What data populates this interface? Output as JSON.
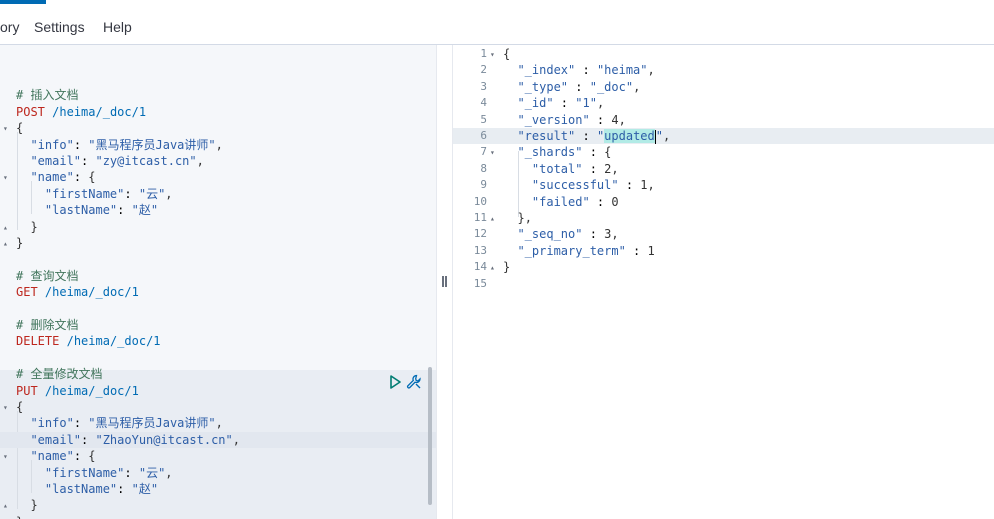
{
  "menu": {
    "history": "ory",
    "settings": "Settings",
    "help": "Help"
  },
  "left": {
    "lines": [
      "",
      "# 插入文档",
      "POST /heima/_doc/1",
      "{",
      "  \"info\": \"黑马程序员Java讲师\",",
      "  \"email\": \"zy@itcast.cn\",",
      "  \"name\": {",
      "    \"firstName\": \"云\",",
      "    \"lastName\": \"赵\"",
      "  }",
      "}",
      "",
      "# 查询文档",
      "GET /heima/_doc/1",
      "",
      "# 删除文档",
      "DELETE /heima/_doc/1",
      "",
      "# 全量修改文档",
      "PUT /heima/_doc/1",
      "{",
      "  \"info\": \"黑马程序员Java讲师\",",
      "  \"email\": \"ZhaoYun@itcast.cn\",",
      "  \"name\": {",
      "    \"firstName\": \"云\",",
      "    \"lastName\": \"赵\"",
      "  }",
      "}"
    ]
  },
  "right": {
    "line_numbers": [
      "1",
      "2",
      "3",
      "4",
      "5",
      "6",
      "7",
      "8",
      "9",
      "10",
      "11",
      "12",
      "13",
      "14",
      "15"
    ],
    "lines": [
      "{",
      "  \"_index\" : \"heima\",",
      "  \"_type\" : \"_doc\",",
      "  \"_id\" : \"1\",",
      "  \"_version\" : 4,",
      "  \"result\" : \"updated\",",
      "  \"_shards\" : {",
      "    \"total\" : 2,",
      "    \"successful\" : 1,",
      "    \"failed\" : 0",
      "  },",
      "  \"_seq_no\" : 3,",
      "  \"_primary_term\" : 1",
      "}",
      ""
    ]
  },
  "icons": {
    "run": "play-icon",
    "settings": "wrench-icon"
  }
}
